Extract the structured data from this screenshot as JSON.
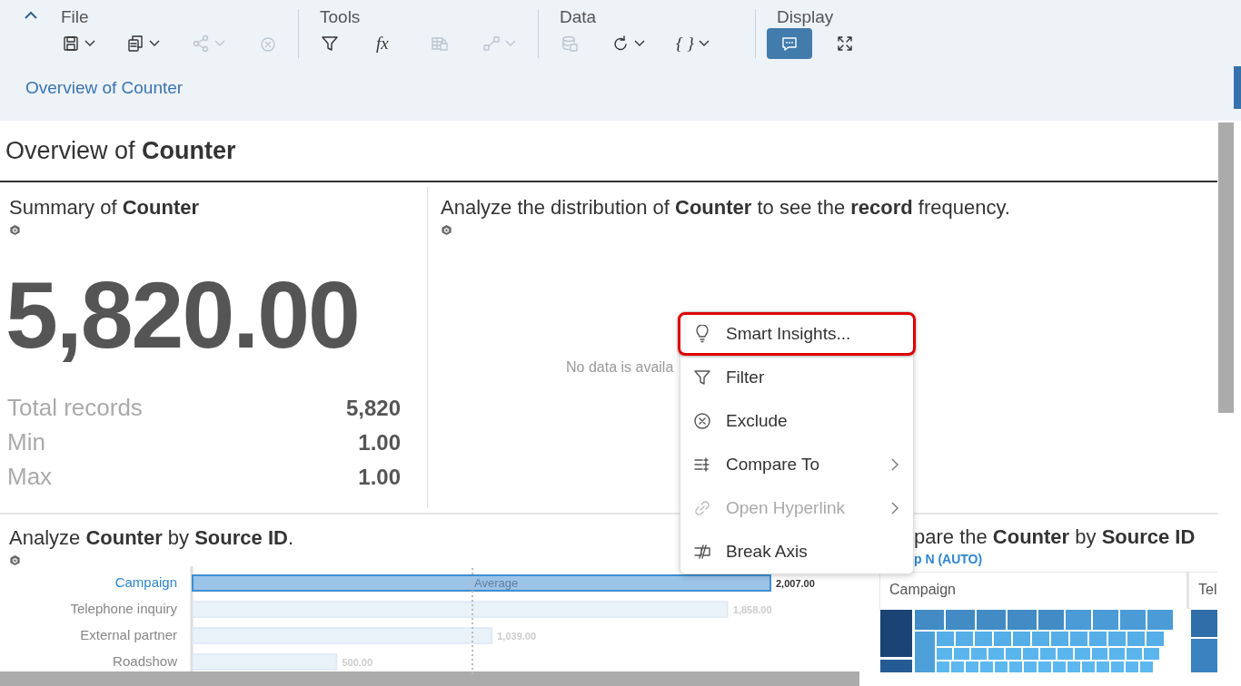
{
  "toolbar": {
    "groups": [
      {
        "label": "File",
        "tools": [
          {
            "kind": "save",
            "dropdown": true,
            "disabled": false,
            "selected": false
          },
          {
            "kind": "copy",
            "dropdown": true,
            "disabled": false,
            "selected": false
          },
          {
            "kind": "share",
            "dropdown": true,
            "disabled": true,
            "selected": false
          },
          {
            "kind": "revert",
            "dropdown": false,
            "disabled": true,
            "selected": false
          }
        ]
      },
      {
        "label": "Tools",
        "tools": [
          {
            "kind": "filter",
            "dropdown": false,
            "disabled": false,
            "selected": false
          },
          {
            "kind": "formula",
            "glyph": "fx",
            "dropdown": false,
            "disabled": false,
            "selected": false
          },
          {
            "kind": "table-lock",
            "dropdown": false,
            "disabled": true,
            "selected": false
          },
          {
            "kind": "chart",
            "dropdown": true,
            "disabled": true,
            "selected": false
          }
        ]
      },
      {
        "label": "Data",
        "tools": [
          {
            "kind": "database",
            "dropdown": false,
            "disabled": true,
            "selected": false
          },
          {
            "kind": "refresh",
            "dropdown": true,
            "disabled": false,
            "selected": false
          },
          {
            "kind": "braces",
            "glyph": "{ }",
            "dropdown": true,
            "disabled": false,
            "selected": false
          }
        ]
      },
      {
        "label": "Display",
        "tools": [
          {
            "kind": "comment",
            "dropdown": false,
            "disabled": false,
            "selected": true
          },
          {
            "kind": "fullscreen",
            "dropdown": false,
            "disabled": false,
            "selected": false
          }
        ]
      }
    ]
  },
  "breadcrumb": "Overview of Counter",
  "page_title": "Overview of **Counter**",
  "summary_tile": {
    "title": "Summary of **Counter**",
    "value": "5,820.00",
    "stats": [
      {
        "label": "Total records",
        "value": "5,820"
      },
      {
        "label": "Min",
        "value": "1.00"
      },
      {
        "label": "Max",
        "value": "1.00"
      }
    ]
  },
  "distribution_tile": {
    "title": "Analyze the distribution of **Counter** to see the **record** frequency.",
    "message": "No data is availa"
  },
  "bar_tile": {
    "title": "Analyze **Counter** by **Source ID**.",
    "category_states": [
      {
        "selected": true
      },
      {
        "selected": false
      },
      {
        "selected": false
      },
      {
        "selected": false
      }
    ],
    "chart_data": {
      "type": "bar",
      "orientation": "horizontal",
      "categories": [
        "Campaign",
        "Telephone inquiry",
        "External partner",
        "Roadshow"
      ],
      "values": [
        2007,
        1858,
        1039,
        500
      ],
      "value_labels": [
        "2,007.00",
        "1,858.00",
        "1,039.00",
        "500.00"
      ],
      "annotations": [
        {
          "text": "Average"
        }
      ]
    }
  },
  "treemap_tile": {
    "title": "pare the **Counter** by **Source ID**",
    "subtitle": "p N (AUTO)",
    "headers": [
      "Campaign",
      "Tel"
    ]
  },
  "context_menu": {
    "items": [
      {
        "kind": "insights",
        "label": "Smart Insights...",
        "highlighted": true,
        "disabled": false,
        "submenu": false
      },
      {
        "kind": "filter",
        "label": "Filter",
        "highlighted": false,
        "disabled": false,
        "submenu": false
      },
      {
        "kind": "exclude",
        "label": "Exclude",
        "highlighted": false,
        "disabled": false,
        "submenu": false
      },
      {
        "kind": "compare",
        "label": "Compare To",
        "highlighted": false,
        "disabled": false,
        "submenu": true
      },
      {
        "kind": "link",
        "label": "Open Hyperlink",
        "highlighted": false,
        "disabled": true,
        "submenu": true
      },
      {
        "kind": "break-axis",
        "label": "Break Axis",
        "highlighted": false,
        "disabled": false,
        "submenu": false
      }
    ]
  }
}
